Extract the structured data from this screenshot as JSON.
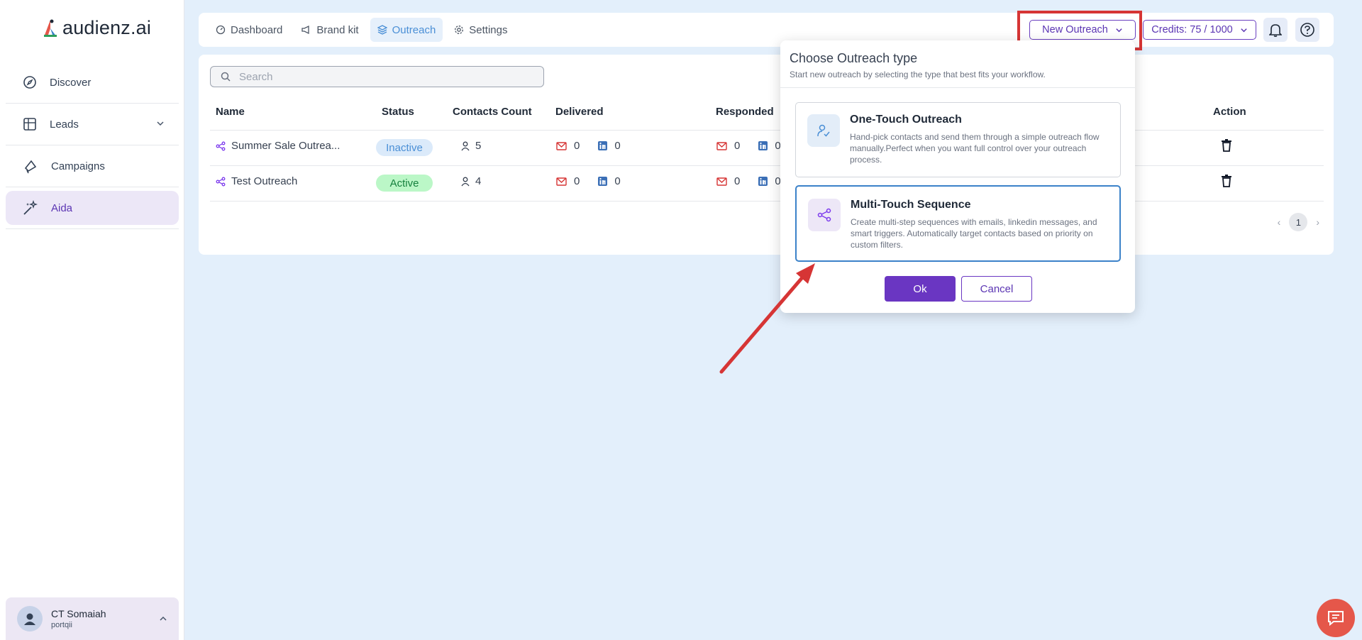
{
  "app": {
    "logo_text": "audienz.ai"
  },
  "sidebar": {
    "items": [
      {
        "label": "Discover",
        "icon": "compass-icon"
      },
      {
        "label": "Leads",
        "icon": "table-icon"
      },
      {
        "label": "Campaigns",
        "icon": "megaphone-icon"
      },
      {
        "label": "Aida",
        "icon": "sparkles-icon"
      }
    ],
    "user": {
      "name": "CT Somaiah",
      "org": "portqii"
    }
  },
  "topbar": {
    "tabs": [
      {
        "label": "Dashboard",
        "icon": "dashboard-icon"
      },
      {
        "label": "Brand kit",
        "icon": "megaphone-icon"
      },
      {
        "label": "Outreach",
        "icon": "layers-icon"
      },
      {
        "label": "Settings",
        "icon": "gear-icon"
      }
    ],
    "new_outreach_label": "New Outreach",
    "credits_label": "Credits: 75 / 1000"
  },
  "table": {
    "search_placeholder": "Search",
    "headers": [
      "Name",
      "Status",
      "Contacts Count",
      "Delivered",
      "Responded",
      "Action"
    ],
    "rows": [
      {
        "name": "Summer Sale Outrea...",
        "status": "Inactive",
        "contacts": "5",
        "delivered_email": "0",
        "delivered_linkedin": "0",
        "responded_email": "0",
        "responded_linkedin": "0"
      },
      {
        "name": "Test Outreach",
        "status": "Active",
        "contacts": "4",
        "delivered_email": "0",
        "delivered_linkedin": "0",
        "responded_email": "0",
        "responded_linkedin": "0"
      }
    ],
    "page": "1"
  },
  "modal": {
    "title": "Choose Outreach type",
    "subtitle": "Start new outreach by selecting the type that best fits your workflow.",
    "options": [
      {
        "title": "One-Touch Outreach",
        "description": "Hand-pick contacts and send them through a simple outreach flow manually.Perfect when you want full control over your outreach process."
      },
      {
        "title": "Multi-Touch Sequence",
        "description": "Create multi-step sequences with emails, linkedin messages, and smart triggers. Automatically target contacts based on priority on custom filters."
      }
    ],
    "ok_label": "Ok",
    "cancel_label": "Cancel"
  },
  "colors": {
    "accent": "#6a36c2",
    "annotation": "#d63535",
    "active_tab": "#4a8fd6"
  }
}
